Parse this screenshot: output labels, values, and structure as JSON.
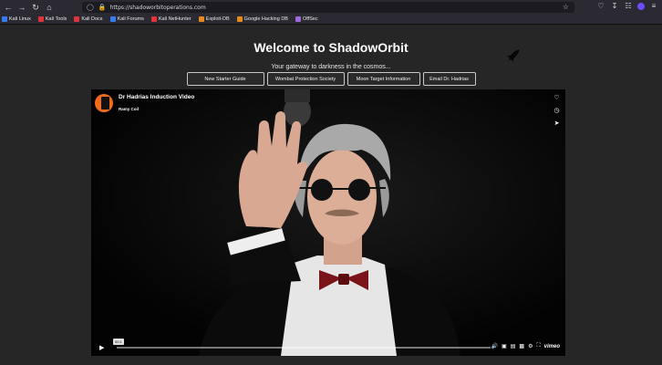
{
  "browser": {
    "url": "https://shadoworbitoperations.com",
    "bookmarks": [
      {
        "label": "Kali Linux",
        "color": "#367bf0"
      },
      {
        "label": "Kali Tools",
        "color": "#e0343a"
      },
      {
        "label": "Kali Docs",
        "color": "#e0343a"
      },
      {
        "label": "Kali Forums",
        "color": "#367bf0"
      },
      {
        "label": "Kali NetHunter",
        "color": "#e0343a"
      },
      {
        "label": "Exploit-DB",
        "color": "#e68a1e"
      },
      {
        "label": "Google Hacking DB",
        "color": "#e68a1e"
      },
      {
        "label": "OffSec",
        "color": "#9c6bd9"
      }
    ]
  },
  "page": {
    "title": "Welcome to ShadowOrbit",
    "tagline": "Your gateway to darkness in the cosmos...",
    "nav_buttons": [
      "New Starter Guide",
      "Wombat Protection Society",
      "Moon Target Information",
      "Email Dr. Hadrias"
    ]
  },
  "video": {
    "title": "Dr Hadrias Induction Video",
    "author": "Ramy Coil",
    "time": "00:1",
    "brand": "vimeo",
    "progress": 0.0
  }
}
